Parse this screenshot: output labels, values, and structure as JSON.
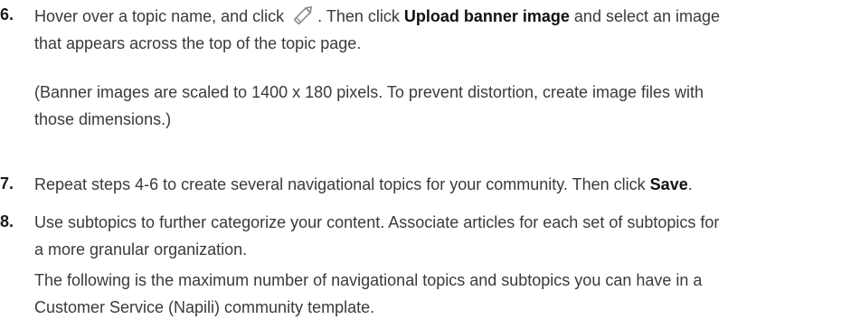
{
  "steps": [
    {
      "number": "6.",
      "lines": [
        {
          "pre": "Hover over a topic name, and click",
          "icon": "pencil-edit-icon",
          "mid": ". Then click ",
          "bold": "Upload banner image",
          "post": " and select an image"
        },
        "that appears across the top of the topic page."
      ],
      "note": [
        "(Banner images are scaled to 1400 x 180 pixels. To prevent distortion, create image files with",
        "those dimensions.)"
      ]
    },
    {
      "number": "7.",
      "line": {
        "pre": "Repeat steps 4-6 to create several navigational topics for your community. Then click ",
        "bold": "Save",
        "post": "."
      }
    },
    {
      "number": "8.",
      "lines": [
        "Use subtopics to further categorize your content. Associate articles for each set of subtopics for",
        "a more granular organization.",
        "The following is the maximum number of navigational topics and subtopics you can have in a",
        "Customer Service (Napili) community template."
      ]
    }
  ],
  "colors": {
    "text": "#3a3a3a",
    "number": "#1a1a1a",
    "icon": "#8a8a8a"
  }
}
